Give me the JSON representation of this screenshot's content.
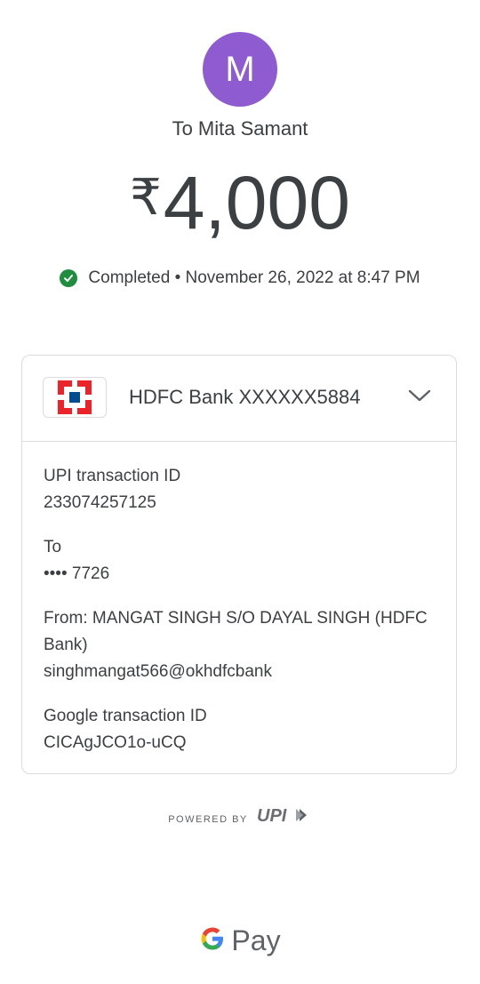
{
  "payee": {
    "initial": "M",
    "label": "To Mita Samant",
    "avatar_color": "#8e5bd1"
  },
  "amount": {
    "currency_symbol": "₹",
    "value": "4,000"
  },
  "status": {
    "text": "Completed • November 26, 2022 at 8:47 PM",
    "icon": "check-circle-icon",
    "color": "#1e8e3e"
  },
  "account": {
    "bank_label": "HDFC Bank XXXXXX5884",
    "logo": "hdfc-logo",
    "expand_icon": "chevron-down-icon"
  },
  "details": [
    {
      "label": "UPI transaction ID",
      "value": "233074257125"
    },
    {
      "label": "To",
      "value": "•••• 7726"
    },
    {
      "label": "From: MANGAT SINGH S/O DAYAL SINGH (HDFC Bank)",
      "value": "singhmangat566@okhdfcbank"
    },
    {
      "label": "Google transaction ID",
      "value": "CICAgJCO1o-uCQ"
    }
  ],
  "footer": {
    "powered_by": "POWERED BY",
    "upi_logo_text": "UPI",
    "brand": "Pay"
  }
}
